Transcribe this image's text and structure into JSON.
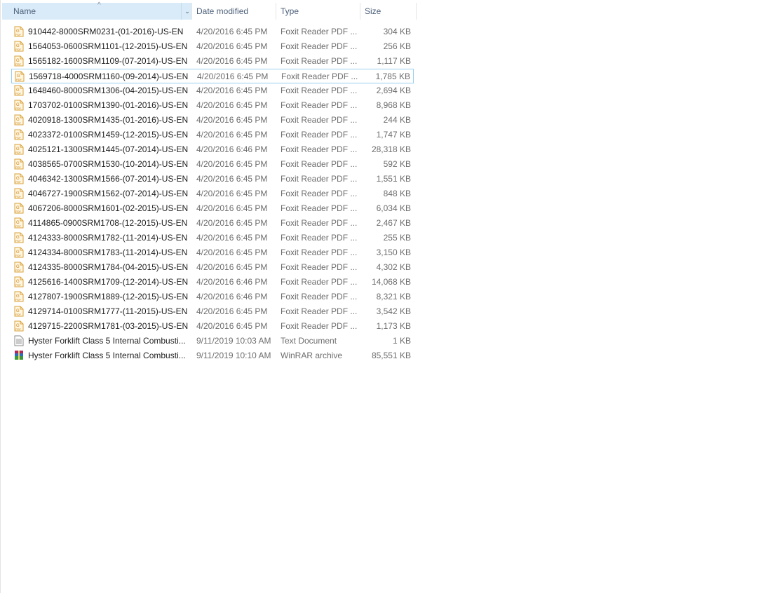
{
  "columns": {
    "name": "Name",
    "date": "Date modified",
    "type": "Type",
    "size": "Size"
  },
  "focused_index": 3,
  "files": [
    {
      "name": "910442-8000SRM0231-(01-2016)-US-EN",
      "date": "4/20/2016 6:45 PM",
      "type": "Foxit Reader PDF ...",
      "size": "304 KB",
      "icon": "pdf-icon"
    },
    {
      "name": "1564053-0600SRM1101-(12-2015)-US-EN",
      "date": "4/20/2016 6:45 PM",
      "type": "Foxit Reader PDF ...",
      "size": "256 KB",
      "icon": "pdf-icon"
    },
    {
      "name": "1565182-1600SRM1109-(07-2014)-US-EN",
      "date": "4/20/2016 6:45 PM",
      "type": "Foxit Reader PDF ...",
      "size": "1,117 KB",
      "icon": "pdf-icon"
    },
    {
      "name": "1569718-4000SRM1160-(09-2014)-US-EN",
      "date": "4/20/2016 6:45 PM",
      "type": "Foxit Reader PDF ...",
      "size": "1,785 KB",
      "icon": "pdf-icon"
    },
    {
      "name": "1648460-8000SRM1306-(04-2015)-US-EN",
      "date": "4/20/2016 6:45 PM",
      "type": "Foxit Reader PDF ...",
      "size": "2,694 KB",
      "icon": "pdf-icon"
    },
    {
      "name": "1703702-0100SRM1390-(01-2016)-US-EN",
      "date": "4/20/2016 6:45 PM",
      "type": "Foxit Reader PDF ...",
      "size": "8,968 KB",
      "icon": "pdf-icon"
    },
    {
      "name": "4020918-1300SRM1435-(01-2016)-US-EN",
      "date": "4/20/2016 6:45 PM",
      "type": "Foxit Reader PDF ...",
      "size": "244 KB",
      "icon": "pdf-icon"
    },
    {
      "name": "4023372-0100SRM1459-(12-2015)-US-EN",
      "date": "4/20/2016 6:45 PM",
      "type": "Foxit Reader PDF ...",
      "size": "1,747 KB",
      "icon": "pdf-icon"
    },
    {
      "name": "4025121-1300SRM1445-(07-2014)-US-EN",
      "date": "4/20/2016 6:46 PM",
      "type": "Foxit Reader PDF ...",
      "size": "28,318 KB",
      "icon": "pdf-icon"
    },
    {
      "name": "4038565-0700SRM1530-(10-2014)-US-EN",
      "date": "4/20/2016 6:45 PM",
      "type": "Foxit Reader PDF ...",
      "size": "592 KB",
      "icon": "pdf-icon"
    },
    {
      "name": "4046342-1300SRM1566-(07-2014)-US-EN",
      "date": "4/20/2016 6:45 PM",
      "type": "Foxit Reader PDF ...",
      "size": "1,551 KB",
      "icon": "pdf-icon"
    },
    {
      "name": "4046727-1900SRM1562-(07-2014)-US-EN",
      "date": "4/20/2016 6:45 PM",
      "type": "Foxit Reader PDF ...",
      "size": "848 KB",
      "icon": "pdf-icon"
    },
    {
      "name": "4067206-8000SRM1601-(02-2015)-US-EN",
      "date": "4/20/2016 6:45 PM",
      "type": "Foxit Reader PDF ...",
      "size": "6,034 KB",
      "icon": "pdf-icon"
    },
    {
      "name": "4114865-0900SRM1708-(12-2015)-US-EN",
      "date": "4/20/2016 6:45 PM",
      "type": "Foxit Reader PDF ...",
      "size": "2,467 KB",
      "icon": "pdf-icon"
    },
    {
      "name": "4124333-8000SRM1782-(11-2014)-US-EN",
      "date": "4/20/2016 6:45 PM",
      "type": "Foxit Reader PDF ...",
      "size": "255 KB",
      "icon": "pdf-icon"
    },
    {
      "name": "4124334-8000SRM1783-(11-2014)-US-EN",
      "date": "4/20/2016 6:45 PM",
      "type": "Foxit Reader PDF ...",
      "size": "3,150 KB",
      "icon": "pdf-icon"
    },
    {
      "name": "4124335-8000SRM1784-(04-2015)-US-EN",
      "date": "4/20/2016 6:45 PM",
      "type": "Foxit Reader PDF ...",
      "size": "4,302 KB",
      "icon": "pdf-icon"
    },
    {
      "name": "4125616-1400SRM1709-(12-2014)-US-EN",
      "date": "4/20/2016 6:46 PM",
      "type": "Foxit Reader PDF ...",
      "size": "14,068 KB",
      "icon": "pdf-icon"
    },
    {
      "name": "4127807-1900SRM1889-(12-2015)-US-EN",
      "date": "4/20/2016 6:46 PM",
      "type": "Foxit Reader PDF ...",
      "size": "8,321 KB",
      "icon": "pdf-icon"
    },
    {
      "name": "4129714-0100SRM1777-(11-2015)-US-EN",
      "date": "4/20/2016 6:45 PM",
      "type": "Foxit Reader PDF ...",
      "size": "3,542 KB",
      "icon": "pdf-icon"
    },
    {
      "name": "4129715-2200SRM1781-(03-2015)-US-EN",
      "date": "4/20/2016 6:45 PM",
      "type": "Foxit Reader PDF ...",
      "size": "1,173 KB",
      "icon": "pdf-icon"
    },
    {
      "name": "Hyster Forklift Class 5 Internal Combusti...",
      "date": "9/11/2019 10:03 AM",
      "type": "Text Document",
      "size": "1 KB",
      "icon": "text-document-icon"
    },
    {
      "name": "Hyster Forklift Class 5 Internal Combusti...",
      "date": "9/11/2019 10:10 AM",
      "type": "WinRAR archive",
      "size": "85,551 KB",
      "icon": "winrar-archive-icon"
    }
  ]
}
